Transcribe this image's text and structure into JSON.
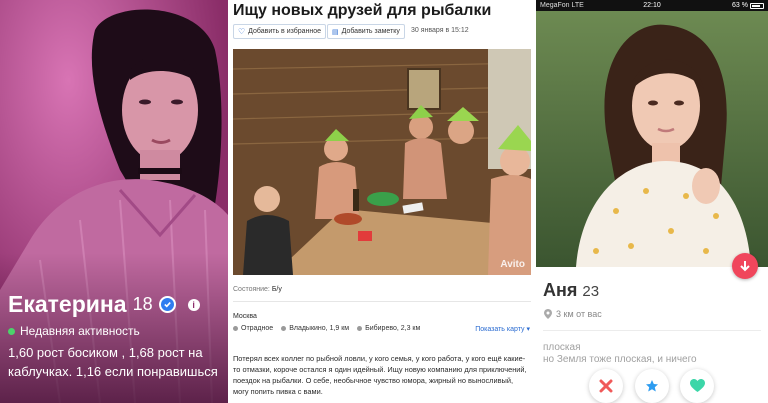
{
  "panel_dating_pink": {
    "name": "Екатерина",
    "age": "18",
    "activity": "Недавняя активность",
    "bio": "1,60 рост босиком , 1,68 рост на каблучках. 1,16 если понравишься",
    "icons": [
      "verified-badge-icon",
      "info-icon",
      "online-dot-icon"
    ]
  },
  "panel_ad": {
    "title": "Ищу новых друзей для рыбалки",
    "favorite_label": "Добавить в избранное",
    "note_label": "Добавить заметку",
    "date": "30 января в 15:12",
    "watermark": "Avito",
    "condition_label": "Состояние:",
    "condition_value": "Б/у",
    "city": "Москва",
    "metro": [
      {
        "name": "Отрадное",
        "color": "#9a9a9a"
      },
      {
        "name": "Владыкино, 1,9 км",
        "color": "#9a9a9a"
      },
      {
        "name": "Бибирево, 2,3 км",
        "color": "#9a9a9a"
      }
    ],
    "map_link": "Показать карту",
    "description": "Потерял всех коллег по рыбной ловли, у кого семья, у кого работа, у кого ещё какие-то отмазки, короче остался я один идейный. Ищу новую компанию для приключений, поездок на рыбалки. О себе, необычное чувство юмора, жирный но выносливый, могу попить пивка с вами."
  },
  "panel_tinder": {
    "carrier": "MegaFon LTE",
    "time": "22:10",
    "battery": "63 %",
    "name": "Аня",
    "age": "23",
    "distance": "3 км от вас",
    "bio_line1": "плоская",
    "bio_line2": "но Земля тоже плоская, и ничего",
    "colors": {
      "nope": "#f05a5a",
      "super": "#2d9cf0",
      "like": "#3cd6a8",
      "fab": "#f0465c"
    }
  }
}
